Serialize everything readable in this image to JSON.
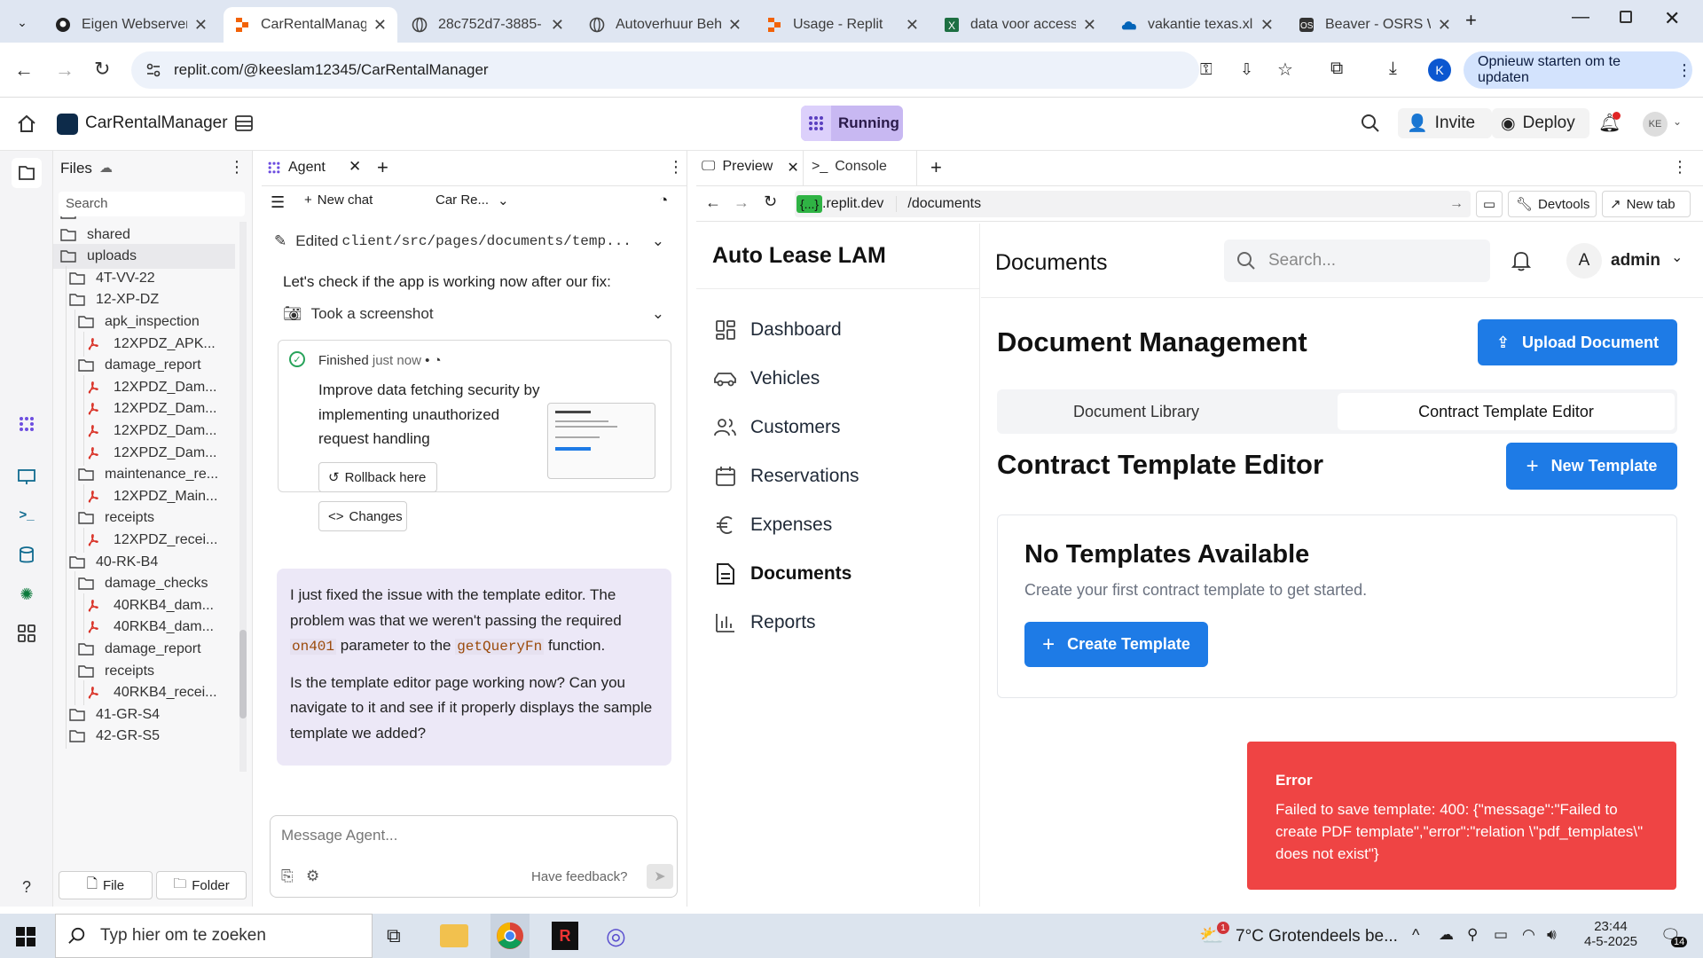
{
  "browser": {
    "tabs": [
      {
        "title": "Eigen Webserver",
        "icon": "github-icon"
      },
      {
        "title": "CarRentalManag",
        "icon": "replit-icon",
        "active": true
      },
      {
        "title": "28c752d7-3885-",
        "icon": "globe-icon"
      },
      {
        "title": "Autoverhuur Beh",
        "icon": "globe-icon"
      },
      {
        "title": "Usage - Replit",
        "icon": "replit-icon"
      },
      {
        "title": "data voor access",
        "icon": "excel-icon"
      },
      {
        "title": "vakantie texas.xl",
        "icon": "onedrive-icon"
      },
      {
        "title": "Beaver - OSRS W",
        "icon": "wiki-icon"
      }
    ],
    "url": "replit.com/@keeslam12345/CarRentalManager",
    "update_button": "Opnieuw starten om te updaten",
    "profile_initial": "K"
  },
  "replit": {
    "project_name": "CarRentalManager",
    "status": "Running",
    "invite": "Invite",
    "deploy": "Deploy",
    "avatar": "KE"
  },
  "files": {
    "title": "Files",
    "search_placeholder": "Search",
    "items": [
      {
        "label": "server",
        "depth": 0,
        "type": "folder"
      },
      {
        "label": "shared",
        "depth": 0,
        "type": "folder"
      },
      {
        "label": "uploads",
        "depth": 0,
        "type": "folder"
      },
      {
        "label": "4T-VV-22",
        "depth": 1,
        "type": "folder"
      },
      {
        "label": "12-XP-DZ",
        "depth": 1,
        "type": "folder"
      },
      {
        "label": "apk_inspection",
        "depth": 2,
        "type": "folder"
      },
      {
        "label": "12XPDZ_APK...",
        "depth": 3,
        "type": "pdf"
      },
      {
        "label": "damage_report",
        "depth": 2,
        "type": "folder"
      },
      {
        "label": "12XPDZ_Dam...",
        "depth": 3,
        "type": "pdf"
      },
      {
        "label": "12XPDZ_Dam...",
        "depth": 3,
        "type": "pdf"
      },
      {
        "label": "12XPDZ_Dam...",
        "depth": 3,
        "type": "pdf"
      },
      {
        "label": "12XPDZ_Dam...",
        "depth": 3,
        "type": "pdf"
      },
      {
        "label": "maintenance_re...",
        "depth": 2,
        "type": "folder"
      },
      {
        "label": "12XPDZ_Main...",
        "depth": 3,
        "type": "pdf"
      },
      {
        "label": "receipts",
        "depth": 2,
        "type": "folder"
      },
      {
        "label": "12XPDZ_recei...",
        "depth": 3,
        "type": "pdf"
      },
      {
        "label": "40-RK-B4",
        "depth": 1,
        "type": "folder"
      },
      {
        "label": "damage_checks",
        "depth": 2,
        "type": "folder"
      },
      {
        "label": "40RKB4_dam...",
        "depth": 3,
        "type": "pdf"
      },
      {
        "label": "40RKB4_dam...",
        "depth": 3,
        "type": "pdf"
      },
      {
        "label": "damage_report",
        "depth": 2,
        "type": "folder"
      },
      {
        "label": "receipts",
        "depth": 2,
        "type": "folder"
      },
      {
        "label": "40RKB4_recei...",
        "depth": 3,
        "type": "pdf"
      },
      {
        "label": "41-GR-S4",
        "depth": 1,
        "type": "folder"
      },
      {
        "label": "42-GR-S5",
        "depth": 1,
        "type": "folder"
      }
    ],
    "file_button": "File",
    "folder_button": "Folder"
  },
  "agent": {
    "tab_label": "Agent",
    "new_chat": "New chat",
    "chat_selector": "Car Re...",
    "edited_prefix": "Edited ",
    "edited_path": "client/src/pages/documents/temp...",
    "check_text": "Let's check if the app is working now after our fix:",
    "screenshot_text": "Took a screenshot",
    "finished_label": "Finished",
    "finished_time": "just now",
    "checkpoint_text": "Improve data fetching security by implementing unauthorized request handling",
    "rollback_button": "Rollback here",
    "changes_button": "Changes",
    "msg_p1_a": "I just fixed the issue with the template editor. The problem was that we weren't passing the required ",
    "msg_code1": "on401",
    "msg_p1_b": " parameter to the ",
    "msg_code2": "getQueryFn",
    "msg_p1_c": " function.",
    "msg_p2": "Is the template editor page working now? Can you navigate to it and see if it properly displays the sample template we added?",
    "input_placeholder": "Message Agent...",
    "feedback": "Have feedback?"
  },
  "preview": {
    "tab_preview": "Preview",
    "tab_console": "Console",
    "domain_badge": "{...}",
    "domain_suffix": ".replit.dev",
    "path": "/documents",
    "devtools": "Devtools",
    "new_tab": "New tab"
  },
  "app": {
    "brand": "Auto Lease LAM",
    "nav": [
      {
        "label": "Dashboard",
        "icon": "dashboard-icon"
      },
      {
        "label": "Vehicles",
        "icon": "car-icon"
      },
      {
        "label": "Customers",
        "icon": "users-icon"
      },
      {
        "label": "Reservations",
        "icon": "calendar-icon"
      },
      {
        "label": "Expenses",
        "icon": "euro-icon"
      },
      {
        "label": "Documents",
        "icon": "document-icon",
        "active": true
      },
      {
        "label": "Reports",
        "icon": "chart-icon"
      }
    ],
    "page_title": "Documents",
    "search_placeholder": "Search...",
    "user_initial": "A",
    "user_name": "admin",
    "heading": "Document Management",
    "upload_button": "Upload Document",
    "tabs": [
      "Document Library",
      "Contract Template Editor"
    ],
    "section_title": "Contract Template Editor",
    "new_template_button": "New Template",
    "empty_title": "No Templates Available",
    "empty_text": "Create your first contract template to get started.",
    "create_button": "Create Template",
    "error_title": "Error",
    "error_text": "Failed to save template: 400: {\"message\":\"Failed to create PDF template\",\"error\":\"relation \\\"pdf_templates\\\" does not exist\"}"
  },
  "taskbar": {
    "search_placeholder": "Typ hier om te zoeken",
    "weather_temp": "7°C",
    "weather_text": "Grotendeels be...",
    "weather_badge": "1",
    "time": "23:44",
    "date": "4-5-2025",
    "notif_count": "14"
  },
  "colors": {
    "accent": "#1e7be6",
    "error": "#ef4444",
    "running": "#c8b8f2"
  }
}
